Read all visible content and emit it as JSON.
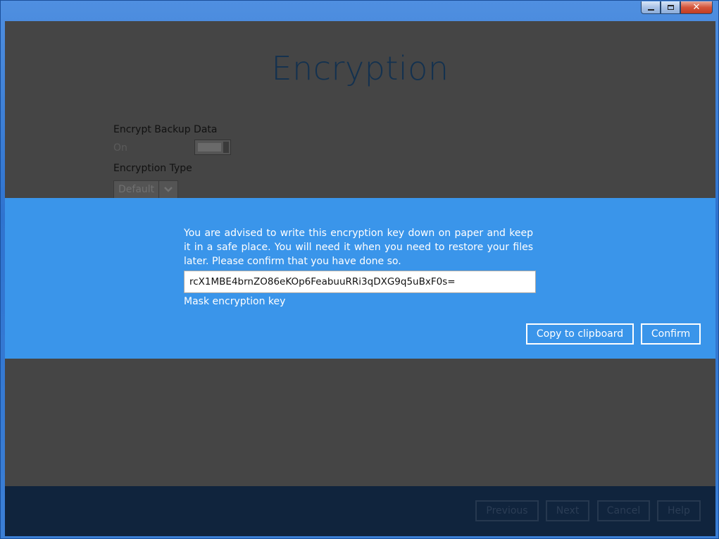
{
  "window": {
    "controls": {
      "minimize_icon": "minimize-icon",
      "maximize_icon": "maximize-icon",
      "close_icon": "close-icon",
      "close_glyph": "✕"
    }
  },
  "page": {
    "title": "Encryption",
    "encrypt_label": "Encrypt Backup Data",
    "encrypt_state": "On",
    "encryption_type_label": "Encryption Type",
    "encryption_type_value": "Default"
  },
  "modal": {
    "advisory": "You are advised to write this encryption key down on paper and keep it in a safe place. You will need it when you need to restore your files later. Please confirm that you have done so.",
    "encryption_key": "rcX1MBE4brnZO86eKOp6FeabuuRRi3qDXG9q5uBxF0s=",
    "mask_link": "Mask encryption key",
    "copy_button": "Copy to clipboard",
    "confirm_button": "Confirm"
  },
  "footer": {
    "previous": "Previous",
    "next": "Next",
    "cancel": "Cancel",
    "help": "Help"
  },
  "colors": {
    "modal_band": "#3a95ea",
    "overlay": "#454545",
    "footer": "#10243d"
  }
}
